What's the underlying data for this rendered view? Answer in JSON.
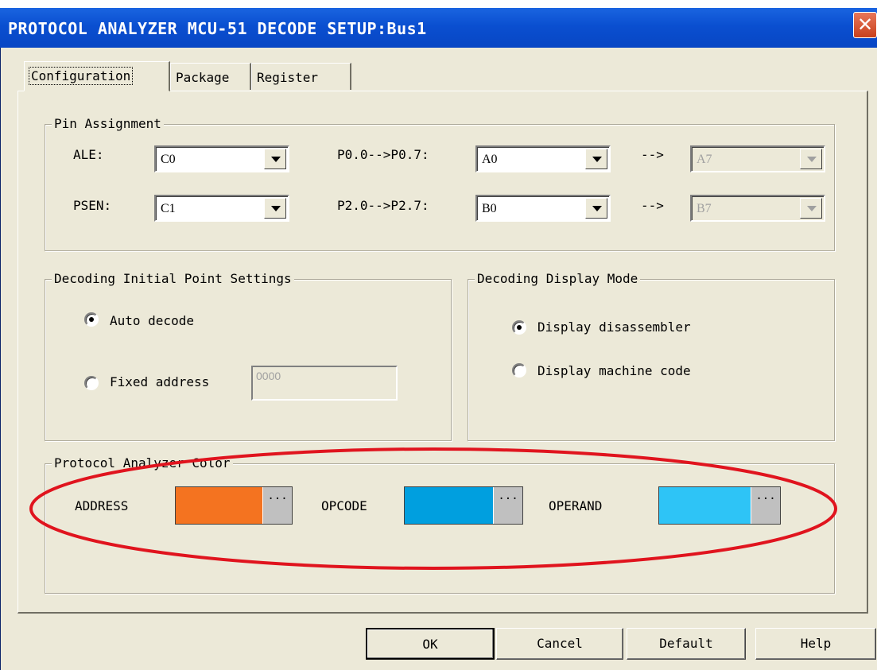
{
  "window": {
    "title": "PROTOCOL ANALYZER MCU-51 DECODE SETUP:Bus1",
    "close_glyph": "✕"
  },
  "tabs": [
    {
      "label": "Configuration",
      "selected": true
    },
    {
      "label": "Package",
      "selected": false
    },
    {
      "label": "Register",
      "selected": false
    }
  ],
  "pin_assignment": {
    "title": "Pin Assignment",
    "ale_label": "ALE:",
    "ale_value": "C0",
    "psen_label": "PSEN:",
    "psen_value": "C1",
    "p0_label": "P0.0-->P0.7:",
    "p0_value": "A0",
    "p0_arrow": "-->",
    "p0_end": "A7",
    "p2_label": "P2.0-->P2.7:",
    "p2_value": "B0",
    "p2_arrow": "-->",
    "p2_end": "B7"
  },
  "initial_point": {
    "title": "Decoding Initial Point Settings",
    "auto_label": "Auto decode",
    "auto_checked": true,
    "fixed_label": "Fixed address",
    "fixed_checked": false,
    "fixed_value": "0000"
  },
  "display_mode": {
    "title": "Decoding Display Mode",
    "disassembler_label": "Display disassembler",
    "disassembler_checked": true,
    "machine_label": "Display machine code",
    "machine_checked": false
  },
  "colors": {
    "title": "Protocol Analyzer Color",
    "address_label": "ADDRESS",
    "address_color": "#f47320",
    "opcode_label": "OPCODE",
    "opcode_color": "#009fdf",
    "operand_label": "OPERAND",
    "operand_color": "#2ec4f6",
    "picker_glyph": "···"
  },
  "buttons": {
    "ok": "OK",
    "cancel": "Cancel",
    "default": "Default",
    "help": "Help"
  },
  "annotation_color": "#e0141e"
}
